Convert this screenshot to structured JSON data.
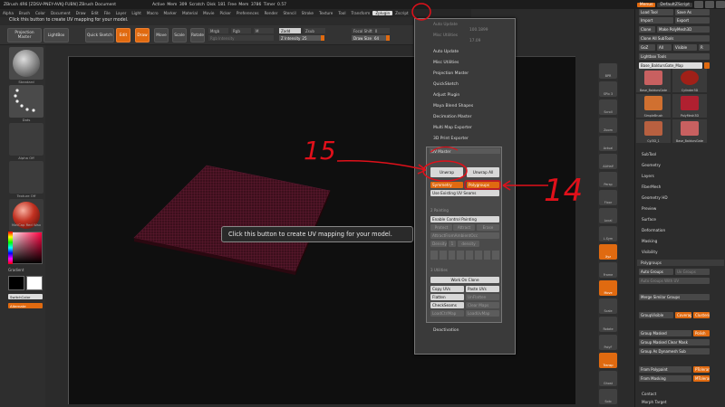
{
  "window": {
    "title": "ZBrush 4R6 [ZDSV-PNEY-AVKJ-FUBN]   ZBrush Document",
    "stats": "Active Mem 309  Scratch Disk 181  Free Mem 3786  Timer 0.57",
    "menus_btn": "Menus",
    "script_btn": "DefaultZScript"
  },
  "menubar": {
    "items": [
      "Alpha",
      "Brush",
      "Color",
      "Document",
      "Draw",
      "Edit",
      "File",
      "Layer",
      "Light",
      "Macro",
      "Marker",
      "Material",
      "Movie",
      "Picker",
      "Preferences",
      "Render",
      "Stencil",
      "Stroke",
      "Texture",
      "Tool",
      "Transform",
      "Zplugin",
      "Zscript"
    ],
    "active_index": 21
  },
  "hint_text": "Click this button to create UV mapping for your model.",
  "toolbar": {
    "projection_master": "Projection Master",
    "lightbox": "LightBox",
    "quick_sketch": "Quick Sketch",
    "edit": "Edit",
    "draw": "Draw",
    "move": "Move",
    "scale": "Scale",
    "rotate": "Rotate",
    "mrgb": "Mrgb",
    "rgb": "Rgb",
    "m": "M",
    "zadd": "Zadd",
    "zsub": "Zsub",
    "zcut": "Zcut",
    "rgb_intensity": "Rgb Intensity",
    "z_intensity_label": "Z Intensity",
    "z_intensity_value": "25",
    "focal_shift": "Focal Shift",
    "focal_shift_value": "0",
    "draw_size": "Draw Size",
    "draw_size_value": "64"
  },
  "left_shelf": {
    "brush_label": "Standard",
    "stroke_label": "Dots",
    "alpha_label": "Alpha Off",
    "texture_label": "Texture Off",
    "material_label": "MatCap Red Wax",
    "gradient_label": "Gradient",
    "switch_color": "SwitchColor",
    "alternate": "Alternate"
  },
  "dropdown": {
    "ghost_items": [
      "Auto Update",
      "Misc Utilities",
      "Projection Master",
      "QuickSketch"
    ],
    "items": [
      "Auto Update",
      "Misc Utilities",
      "Projection Master",
      "QuickSketch",
      "Adjust Plugin",
      "Maya Blend Shapes",
      "Decimation Master",
      "Multi Map Exporter",
      "3D Print Exporter",
      "SubTool Master",
      "Transpose Master"
    ],
    "footer": "Deactivation",
    "ghost_values": [
      "100.1899",
      "17.09"
    ]
  },
  "uv_master": {
    "title": "UV Master",
    "unwrap": "Unwrap",
    "unwrap_all": "Unwrap All",
    "symmetry": "Symmetry",
    "polygroups": "Polygroups",
    "use_existing": "Use Existing UV Seams",
    "painting_header": "2 Painting",
    "enable_painting": "Enable Control Painting",
    "protect": "Protect",
    "attract": "Attract",
    "erase": "Erase",
    "attract_from_ao": "AttractFromAmbientOcc",
    "density": "Density",
    "density_value": "1",
    "density_unit": "density",
    "utilities_header": "3 Utilities",
    "work_on_clone": "Work On Clone",
    "copy_uvs": "Copy UVs",
    "paste_uvs": "Paste UVs",
    "flatten": "Flatten",
    "unflatten": "UnFlatten",
    "check_seams": "CheckSeams",
    "clear_maps": "Clear Maps",
    "load_ctrl_map": "LoadCtrlMap",
    "load_uv_map": "LoadUvMap"
  },
  "tooltip": "Click this button to create UV mapping for your model.",
  "right_shelf": [
    "BPR",
    "SPix 3",
    "Scroll",
    "Zoom",
    "Actual",
    "AAHalf",
    "Persp",
    "Floor",
    "Local",
    "L.Sym",
    "Xyz",
    "Frame",
    "Move",
    "Scale",
    "Rotate",
    "PolyF",
    "Transp",
    "Ghost",
    "Solo"
  ],
  "right_panel": {
    "load_tool": "Load Tool",
    "save_as": "Save As",
    "import": "Import",
    "export": "Export",
    "clone": "Clone",
    "make_polymesh": "Make PolyMesh3D",
    "clone_all": "Clone All SubTools",
    "goz": "GoZ",
    "all": "All",
    "visible": "Visible",
    "r": "R",
    "lightbox_tools": "Lightbox  Tools",
    "tool_name": "Base_BaldursGate_Map",
    "thumbs": [
      "Base_BaldursGate",
      "Cylinder3D",
      "SimpleBrush",
      "PolyMesh3D",
      "Cyl3D_1",
      "Base_BaldursGate"
    ],
    "sections": [
      "SubTool",
      "Geometry",
      "Layers",
      "FiberMesh",
      "Geometry HD",
      "Preview",
      "Surface",
      "Deformation",
      "Masking",
      "Visibility"
    ],
    "polygroups_header": "Polygroups",
    "auto_groups": "Auto Groups",
    "uv_groups": "Uv Groups",
    "auto_groups_uv": "Auto Groups With UV",
    "merge_similar": "Merge Similar Groups",
    "group_visible": "GroupVisible",
    "coverage": "Coverage",
    "clustering": "Clustering",
    "group_masked": "Group Masked",
    "polish": "Polish",
    "group_masked_clear": "Group Masked Clear Mask",
    "group_as_dynamesh": "Group As Dynamesh Sub",
    "from_polypaint": "From Polypaint",
    "ptolerance": "PTolerance",
    "from_masking": "From Masking",
    "mtolerance": "MTolerance",
    "contact": "Contact",
    "morph_target": "Morph Target"
  },
  "annotations": {
    "label_15": "15",
    "label_14": "14"
  },
  "colors": {
    "accent": "#e06a10",
    "annotation": "#e0101a",
    "mesh": "#4a1424"
  }
}
